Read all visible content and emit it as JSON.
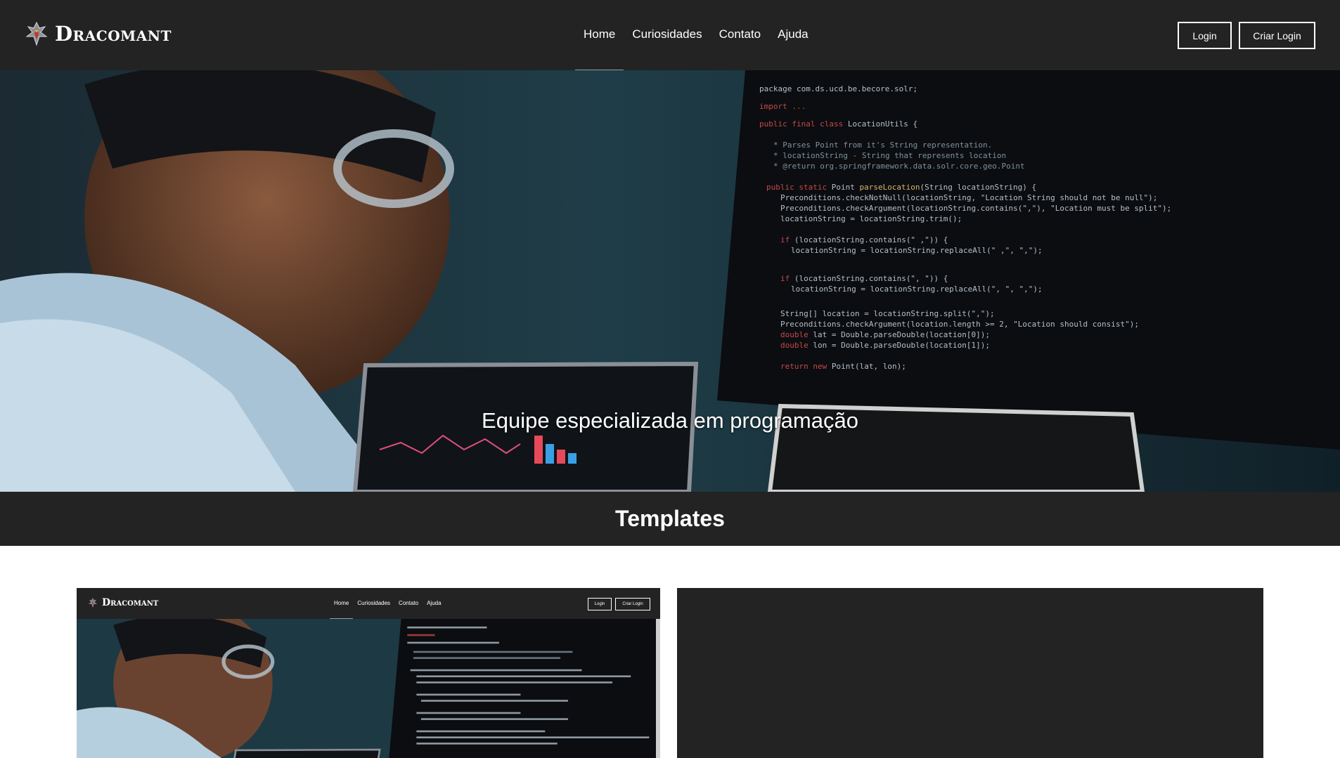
{
  "brand": {
    "name": "Dracomant",
    "logo": "dragon-logo"
  },
  "nav": {
    "items": [
      {
        "label": "Home",
        "active": true
      },
      {
        "label": "Curiosidades",
        "active": false
      },
      {
        "label": "Contato",
        "active": false
      },
      {
        "label": "Ajuda",
        "active": false
      }
    ],
    "login_label": "Login",
    "signup_label": "Criar Login"
  },
  "hero": {
    "caption": "Equipe especializada em programação",
    "image": "developer-with-code-monitors-photo"
  },
  "templates": {
    "title": "Templates",
    "cards": [
      {
        "kind": "site-preview",
        "brand": "Dracomant",
        "nav_items": [
          "Home",
          "Curiosidades",
          "Contato",
          "Ajuda"
        ],
        "login_label": "Login",
        "signup_label": "Criar Login",
        "image": "developer-with-code-monitors-photo"
      },
      {
        "kind": "empty-dark-panel"
      }
    ]
  },
  "colors": {
    "nav_bg": "#232323",
    "text": "#ffffff",
    "page_bg": "#ffffff"
  }
}
